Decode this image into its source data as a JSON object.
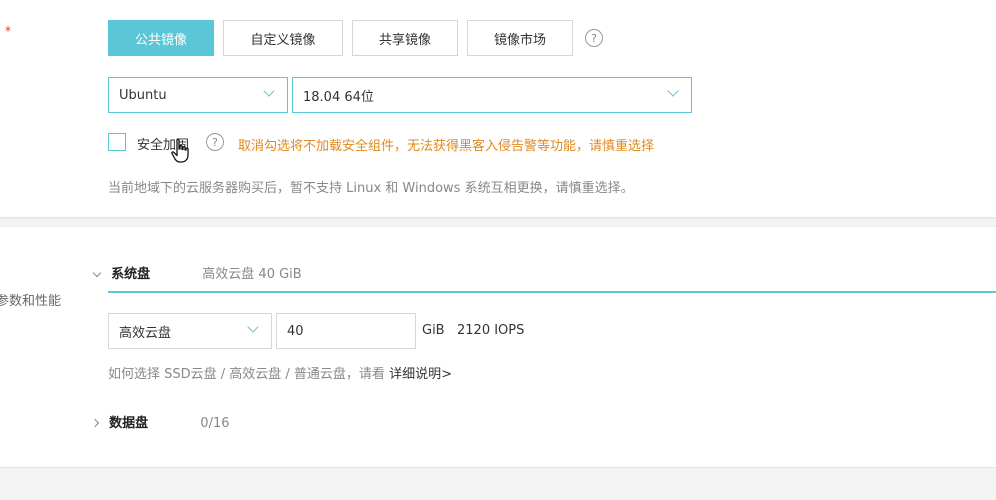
{
  "required_mark": "*",
  "image_tabs": [
    {
      "label": "公共镜像",
      "active": true
    },
    {
      "label": "自定义镜像",
      "active": false
    },
    {
      "label": "共享镜像",
      "active": false
    },
    {
      "label": "镜像市场",
      "active": false
    }
  ],
  "help_glyph": "?",
  "os_select": {
    "value": "Ubuntu"
  },
  "version_select": {
    "value": "18.04 64位"
  },
  "security": {
    "label": "安全加固",
    "warning": "取消勾选将不加载安全组件，无法获得黑客入侵告警等功能，请慎重选择"
  },
  "region_note": "当前地域下的云服务器购买后，暂不支持 Linux 和 Windows 系统互相更换，请慎重选择。",
  "section_label": "参数和性能",
  "system_disk": {
    "title": "系统盘",
    "summary": "高效云盘 40 GiB",
    "type_select": "高效云盘",
    "size_value": "40",
    "unit_iops": "GiB   2120 IOPS",
    "help_text": "如何选择 SSD云盘 / 高效云盘 / 普通云盘，请看",
    "help_link": "详细说明>"
  },
  "data_disk": {
    "title": "数据盘",
    "count": "0/16"
  },
  "colors": {
    "accent": "#5bc6d7",
    "warning": "#e08a1f"
  }
}
